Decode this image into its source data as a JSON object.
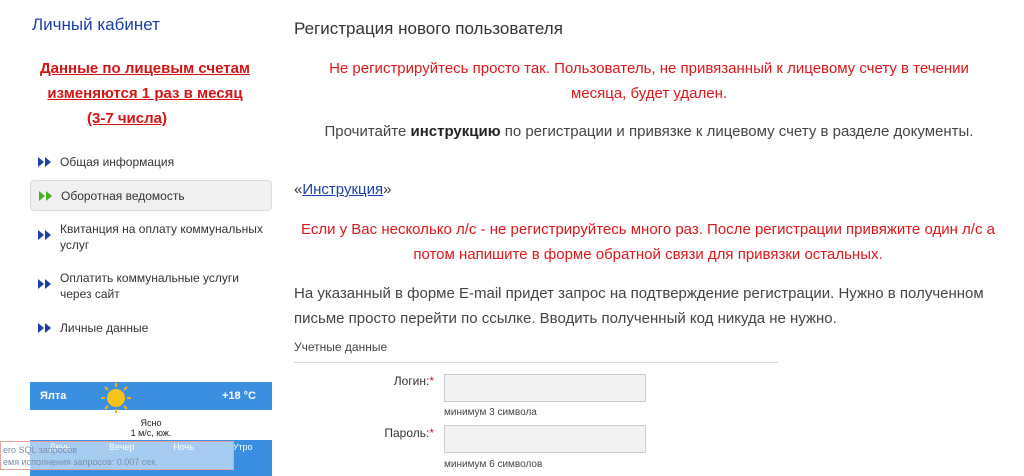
{
  "sidebar": {
    "title": "Личный кабинет",
    "notice_line1": "Данные по лицевым счетам",
    "notice_line2": "изменяются 1 раз в месяц",
    "notice_line3": "(3-7 числа)",
    "nav": [
      {
        "label": "Общая информация"
      },
      {
        "label": "Оборотная ведомость"
      },
      {
        "label": "Квитанция на оплату коммунальных услуг"
      },
      {
        "label": "Оплатить коммунальные услуги через сайт"
      },
      {
        "label": "Личные данные"
      }
    ],
    "nav_arrow_color": "#1c3fa8",
    "nav_active_arrow_color": "#4caf1e"
  },
  "weather": {
    "city": "Ялта",
    "temp": "+18 °C",
    "condition": "Ясно",
    "wind": "1 м/с, юж.",
    "periods": [
      "День",
      "Вечер",
      "Ночь",
      "Утро"
    ]
  },
  "debug": {
    "line1": "ero SQL запросов",
    "line2": "емя исполнения запросов: 0.007 сек."
  },
  "main": {
    "title": "Регистрация нового пользователя",
    "warning1": "Не регистрируйтесь просто так. Пользователь, не привязанный к лицевому счету в течении месяца, будет удален.",
    "instr_before": "Прочитайте ",
    "instr_bold": "инструкцию",
    "instr_after": " по регистрации и привязке к лицевому счету в разделе документы.",
    "link_open": "«",
    "link_text": "Инструкция",
    "link_close": "»",
    "warning2": "Если у Вас несколько л/с - не регистрируйтесь много раз. После регистрации привяжите один л/с а потом напишите в форме обратной связи для привязки остальных.",
    "email_note": "На указанный в форме E-mail придет запрос на подтверждение регистрации. Нужно в полученном письме просто перейти по ссылке. Вводить полученный код никуда не нужно.",
    "section_label": "Учетные данные",
    "login_label": "Логин:",
    "login_value": "",
    "login_hint": "минимум 3 символа",
    "password_label": "Пароль:",
    "password_value": "",
    "password_hint": "минимум 6 символов",
    "required_mark": "*",
    "accent_red": "#e0161b",
    "link_color": "#1c3fa8"
  }
}
